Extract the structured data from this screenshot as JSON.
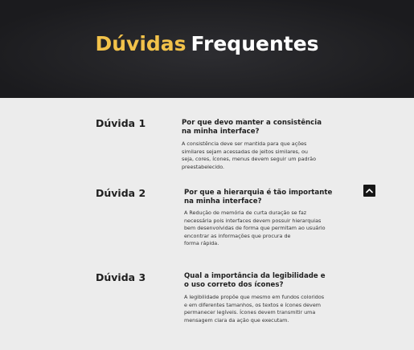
{
  "hero": {
    "title_highlight": "Dúvidas",
    "title_rest": "Frequentes"
  },
  "faq": [
    {
      "label": "Dúvida 1",
      "question_lines": [
        "Por que devo manter a consistência",
        "na minha interface?"
      ],
      "answer_lines": [
        "A consistência deve ser mantida para que ações",
        "similares sejam acessadas de jeitos similares, ou",
        "seja, cores, ícones, menus devem seguir um padrão",
        "preestabelecido."
      ]
    },
    {
      "label": "Dúvida 2",
      "question_lines": [
        "Por que a hierarquia é tão importante",
        "na minha interface?"
      ],
      "answer_lines": [
        "A Redução de memória de curta duração se faz",
        "necessária pois interfaces devem possuir hierarquias",
        "bem desenvolvidas de forma que permitam ao usuário",
        "encontrar as informações que procura de",
        "forma rápida."
      ]
    },
    {
      "label": "Dúvida 3",
      "question_lines": [
        "Qual a importância da legibilidade e",
        "o uso correto dos ícones?"
      ],
      "answer_lines": [
        "A legibilidade propõe que mesmo em fundos coloridos",
        "e em diferentes tamanhos, os textos e ícones devem",
        "permanecer legíveis. Ícones devem transmitir uma",
        "mensagem clara da ação que executam."
      ]
    }
  ],
  "scroll_top": {
    "icon": "chevron-up-icon"
  }
}
